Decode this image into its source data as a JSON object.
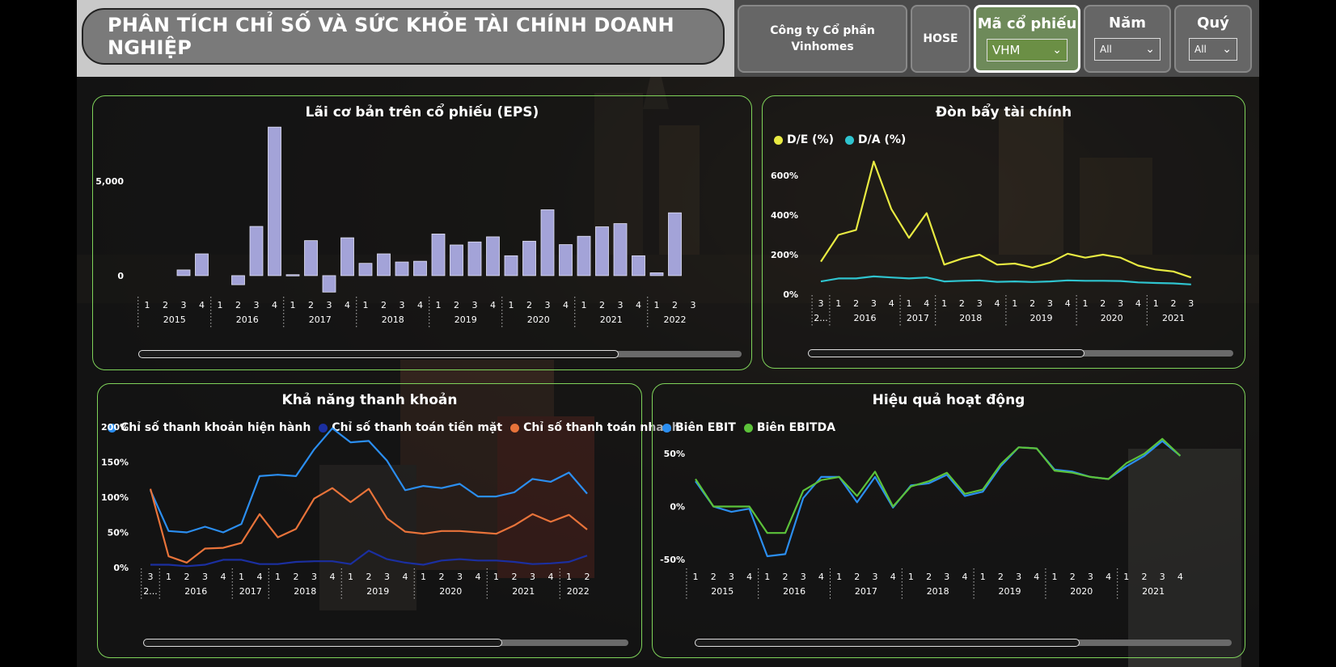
{
  "header": {
    "title": "PHÂN TÍCH CHỈ SỐ VÀ SỨC KHỎE TÀI CHÍNH DOANH NGHIỆP",
    "company": "Công ty Cổ phần Vinhomes",
    "exchange": "HOSE",
    "ticker_label": "Mã cổ phiếu",
    "ticker_value": "VHM",
    "year_label": "Năm",
    "year_value": "All",
    "quarter_label": "Quý",
    "quarter_value": "All"
  },
  "eps": {
    "title": "Lãi cơ bản trên cổ phiếu (EPS)",
    "chart_data": {
      "type": "bar",
      "title": "Lãi cơ bản trên cổ phiếu (EPS)",
      "y_ticks": [
        "5,000",
        "0"
      ],
      "ylim": [
        -1200,
        8200
      ],
      "year_groups": [
        {
          "year": "2015",
          "quarters": [
            "1",
            "2",
            "3",
            "4"
          ]
        },
        {
          "year": "2016",
          "quarters": [
            "1",
            "2",
            "3",
            "4"
          ]
        },
        {
          "year": "2017",
          "quarters": [
            "1",
            "2",
            "3",
            "4"
          ]
        },
        {
          "year": "2018",
          "quarters": [
            "1",
            "2",
            "3",
            "4"
          ]
        },
        {
          "year": "2019",
          "quarters": [
            "1",
            "2",
            "3",
            "4"
          ]
        },
        {
          "year": "2020",
          "quarters": [
            "1",
            "2",
            "3",
            "4"
          ]
        },
        {
          "year": "2021",
          "quarters": [
            "1",
            "2",
            "3",
            "4"
          ]
        },
        {
          "year": "2022",
          "quarters": [
            "1",
            "2",
            "3"
          ]
        }
      ],
      "values": [
        null,
        null,
        300,
        1150,
        null,
        -480,
        2600,
        7850,
        50,
        1850,
        -870,
        2000,
        650,
        1150,
        720,
        760,
        2200,
        1620,
        1780,
        2050,
        1050,
        1820,
        3480,
        1640,
        2080,
        2580,
        2750,
        1050,
        150,
        3320
      ],
      "color": "#a3a3d8"
    }
  },
  "leverage": {
    "title": "Đòn bẩy tài chính",
    "chart_data": {
      "type": "line",
      "title": "Đòn bẩy tài chính",
      "y_ticks": [
        "600%",
        "400%",
        "200%",
        "0%"
      ],
      "ylim": [
        0,
        600
      ],
      "year_groups": [
        {
          "year": "2...",
          "quarters": [
            "3"
          ]
        },
        {
          "year": "2016",
          "quarters": [
            "1",
            "2",
            "3",
            "4"
          ]
        },
        {
          "year": "2017",
          "quarters": [
            "1",
            "4"
          ]
        },
        {
          "year": "2018",
          "quarters": [
            "1",
            "2",
            "3",
            "4"
          ]
        },
        {
          "year": "2019",
          "quarters": [
            "1",
            "2",
            "3",
            "4"
          ]
        },
        {
          "year": "2020",
          "quarters": [
            "1",
            "2",
            "3",
            "4"
          ]
        },
        {
          "year": "2021",
          "quarters": [
            "1",
            "2",
            "3"
          ]
        }
      ],
      "series": [
        {
          "name": "D/E (%)",
          "color": "#e8ea42",
          "values": [
            165,
            300,
            325,
            670,
            430,
            285,
            410,
            150,
            180,
            200,
            150,
            155,
            135,
            160,
            205,
            185,
            200,
            185,
            145,
            125,
            115,
            85
          ]
        },
        {
          "name": "D/A (%)",
          "color": "#2fc4cf",
          "values": [
            65,
            80,
            80,
            90,
            85,
            80,
            85,
            65,
            68,
            70,
            63,
            65,
            62,
            65,
            70,
            68,
            68,
            67,
            60,
            57,
            55,
            50
          ]
        }
      ]
    }
  },
  "liquidity": {
    "title": "Khả năng thanh khoản",
    "chart_data": {
      "type": "line",
      "title": "Khả năng thanh khoản",
      "y_ticks": [
        "200%",
        "150%",
        "100%",
        "50%",
        "0%"
      ],
      "ylim": [
        0,
        200
      ],
      "year_groups": [
        {
          "year": "2...",
          "quarters": [
            "3"
          ]
        },
        {
          "year": "2016",
          "quarters": [
            "1",
            "2",
            "3",
            "4"
          ]
        },
        {
          "year": "2017",
          "quarters": [
            "1",
            "4"
          ]
        },
        {
          "year": "2018",
          "quarters": [
            "1",
            "2",
            "3",
            "4"
          ]
        },
        {
          "year": "2019",
          "quarters": [
            "1",
            "2",
            "3",
            "4"
          ]
        },
        {
          "year": "2020",
          "quarters": [
            "1",
            "2",
            "3",
            "4"
          ]
        },
        {
          "year": "2021",
          "quarters": [
            "1",
            "2",
            "3",
            "4"
          ]
        },
        {
          "year": "2022",
          "quarters": [
            "1",
            "2"
          ]
        }
      ],
      "series": [
        {
          "name": "Chỉ số thanh khoản hiện hành",
          "color": "#2b8ef0",
          "values": [
            110,
            52,
            50,
            58,
            50,
            62,
            130,
            132,
            130,
            168,
            198,
            178,
            180,
            152,
            110,
            116,
            113,
            119,
            101,
            101,
            107,
            126,
            122,
            135,
            105
          ]
        },
        {
          "name": "Chỉ số thanh toán tiền mặt",
          "color": "#1b2fa0",
          "values": [
            4,
            4,
            2,
            4,
            11,
            11,
            5,
            5,
            8,
            9,
            9,
            5,
            24,
            12,
            7,
            4,
            10,
            12,
            10,
            10,
            8,
            5,
            6,
            8,
            17
          ]
        },
        {
          "name": "Chỉ số thanh toán nhanh",
          "color": "#e8733a",
          "values": [
            112,
            16,
            7,
            27,
            28,
            35,
            76,
            43,
            55,
            98,
            113,
            93,
            112,
            70,
            51,
            48,
            52,
            52,
            50,
            48,
            60,
            76,
            65,
            75,
            54
          ]
        }
      ]
    }
  },
  "efficiency": {
    "title": "Hiệu quả hoạt động",
    "chart_data": {
      "type": "line",
      "title": "Hiệu quả hoạt động",
      "y_ticks": [
        "50%",
        "0%",
        "-50%"
      ],
      "ylim": [
        -60,
        70
      ],
      "year_groups": [
        {
          "year": "2015",
          "quarters": [
            "1",
            "2",
            "3",
            "4"
          ]
        },
        {
          "year": "2016",
          "quarters": [
            "1",
            "2",
            "3",
            "4"
          ]
        },
        {
          "year": "2017",
          "quarters": [
            "1",
            "2",
            "3",
            "4"
          ]
        },
        {
          "year": "2018",
          "quarters": [
            "1",
            "2",
            "3",
            "4"
          ]
        },
        {
          "year": "2019",
          "quarters": [
            "1",
            "2",
            "3",
            "4"
          ]
        },
        {
          "year": "2020",
          "quarters": [
            "1",
            "2",
            "3",
            "4"
          ]
        },
        {
          "year": "2021",
          "quarters": [
            "1",
            "2",
            "3",
            "4"
          ]
        }
      ],
      "series": [
        {
          "name": "Biên EBIT",
          "color": "#2b8ef0",
          "values": [
            24,
            0,
            -5,
            -2,
            -47,
            -45,
            8,
            28,
            28,
            4,
            28,
            -1,
            20,
            22,
            30,
            10,
            14,
            38,
            56,
            55,
            35,
            33,
            28,
            26,
            38,
            48,
            62,
            48
          ]
        },
        {
          "name": "Biên EBITDA",
          "color": "#5cc23a",
          "values": [
            26,
            0,
            0,
            0,
            -25,
            -25,
            15,
            25,
            28,
            10,
            33,
            0,
            19,
            24,
            32,
            12,
            16,
            40,
            56,
            55,
            34,
            32,
            28,
            26,
            41,
            50,
            64,
            48
          ]
        }
      ]
    }
  }
}
